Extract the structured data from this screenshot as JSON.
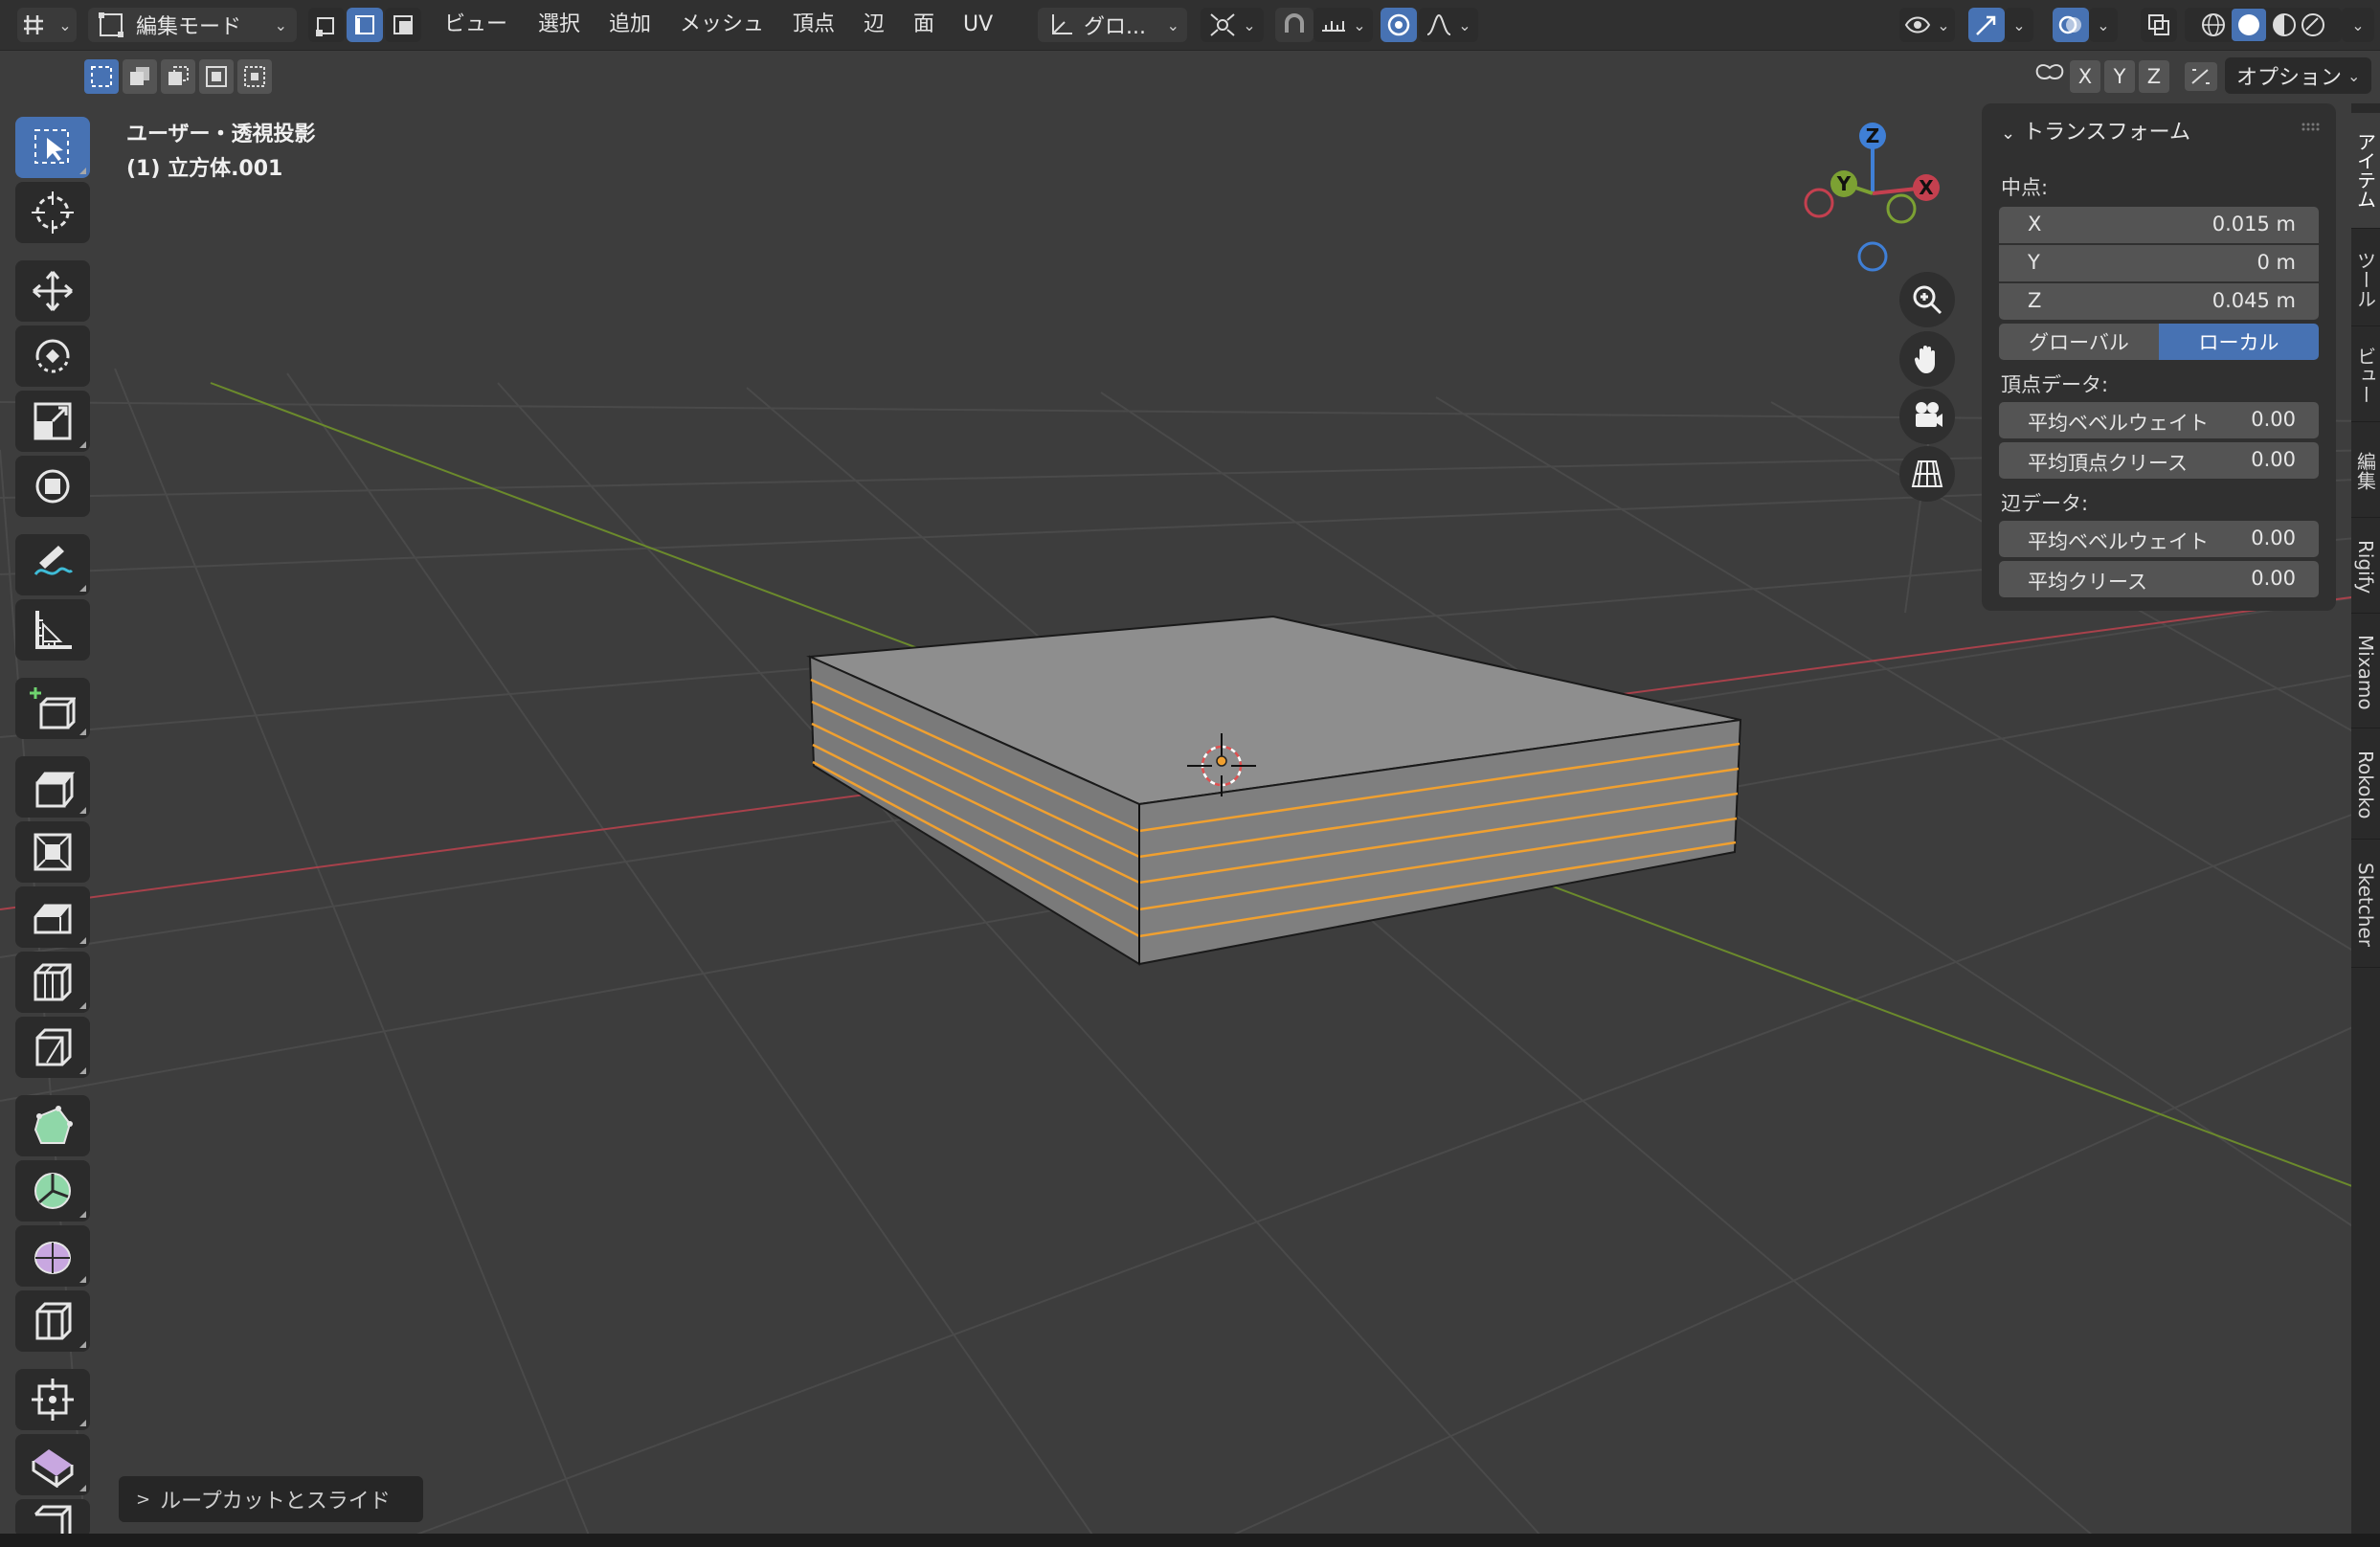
{
  "header": {
    "mode": "編集モード",
    "menus": [
      "ビュー",
      "選択",
      "追加",
      "メッシュ",
      "頂点",
      "辺",
      "面",
      "UV"
    ],
    "orientation": "グロ..."
  },
  "toolbar2": {
    "axes": [
      "X",
      "Y",
      "Z"
    ],
    "options_label": "オプション"
  },
  "viewport": {
    "view_name": "ユーザー・透視投影",
    "object_name": "(1) 立方体.001",
    "gizmo_axes": {
      "x": "X",
      "y": "Y",
      "z": "Z"
    }
  },
  "npanel": {
    "title": "トランスフォーム",
    "median_label": "中点:",
    "median": [
      {
        "axis": "X",
        "value": "0.015 m"
      },
      {
        "axis": "Y",
        "value": "0 m"
      },
      {
        "axis": "Z",
        "value": "0.045 m"
      }
    ],
    "space_global": "グローバル",
    "space_local": "ローカル",
    "vertex_data_label": "頂点データ:",
    "vertex_fields": [
      {
        "label": "平均ベベルウェイト",
        "value": "0.00"
      },
      {
        "label": "平均頂点クリース",
        "value": "0.00"
      }
    ],
    "edge_data_label": "辺データ:",
    "edge_fields": [
      {
        "label": "平均ベベルウェイト",
        "value": "0.00"
      },
      {
        "label": "平均クリース",
        "value": "0.00"
      }
    ]
  },
  "side_tabs": [
    "アイテム",
    "ツール",
    "ビュー",
    "編集",
    "Rigify",
    "Mixamo",
    "Rokoko",
    "Sketcher"
  ],
  "last_operator": "ループカットとスライド",
  "colors": {
    "accent": "#4772b3",
    "x_axis": "#c4404f",
    "y_axis": "#7ca133",
    "z_axis": "#3f7fd6",
    "selected_edge": "#f0a030"
  }
}
